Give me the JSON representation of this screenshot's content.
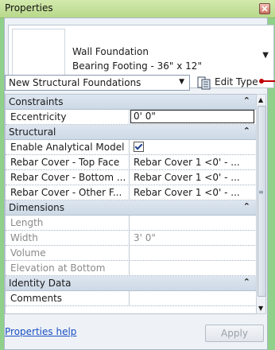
{
  "window": {
    "title": "Properties"
  },
  "type_selector": {
    "family": "Wall Foundation",
    "type": "Bearing Footing - 36\" x 12\""
  },
  "filter": {
    "selected": "New Structural Foundations",
    "edit_type_label": "Edit Type"
  },
  "groups": {
    "constraints": {
      "name": "Constraints",
      "rows": {
        "eccentricity": {
          "label": "Eccentricity",
          "value": "0'  0\""
        }
      }
    },
    "structural": {
      "name": "Structural",
      "rows": {
        "enable_analytical": {
          "label": "Enable Analytical Model",
          "value": "checked"
        },
        "rebar_top": {
          "label": "Rebar Cover - Top Face",
          "value": "Rebar Cover 1 <0' - ..."
        },
        "rebar_bottom": {
          "label": "Rebar Cover - Bottom ...",
          "value": "Rebar Cover 1 <0' - ..."
        },
        "rebar_other": {
          "label": "Rebar Cover - Other F...",
          "value": "Rebar Cover 1 <0' - ..."
        }
      }
    },
    "dimensions": {
      "name": "Dimensions",
      "rows": {
        "length": {
          "label": "Length",
          "value": ""
        },
        "width": {
          "label": "Width",
          "value": "3'  0\""
        },
        "volume": {
          "label": "Volume",
          "value": ""
        },
        "elevation_bottom": {
          "label": "Elevation at Bottom",
          "value": ""
        }
      }
    },
    "identity": {
      "name": "Identity Data",
      "rows": {
        "comments": {
          "label": "Comments",
          "value": ""
        }
      }
    }
  },
  "footer": {
    "help_label": "Properties help",
    "apply_label": "Apply"
  },
  "colors": {
    "accent_green": "#8fd08a",
    "link_blue": "#1a4fc4",
    "callout_red": "#c00000"
  }
}
